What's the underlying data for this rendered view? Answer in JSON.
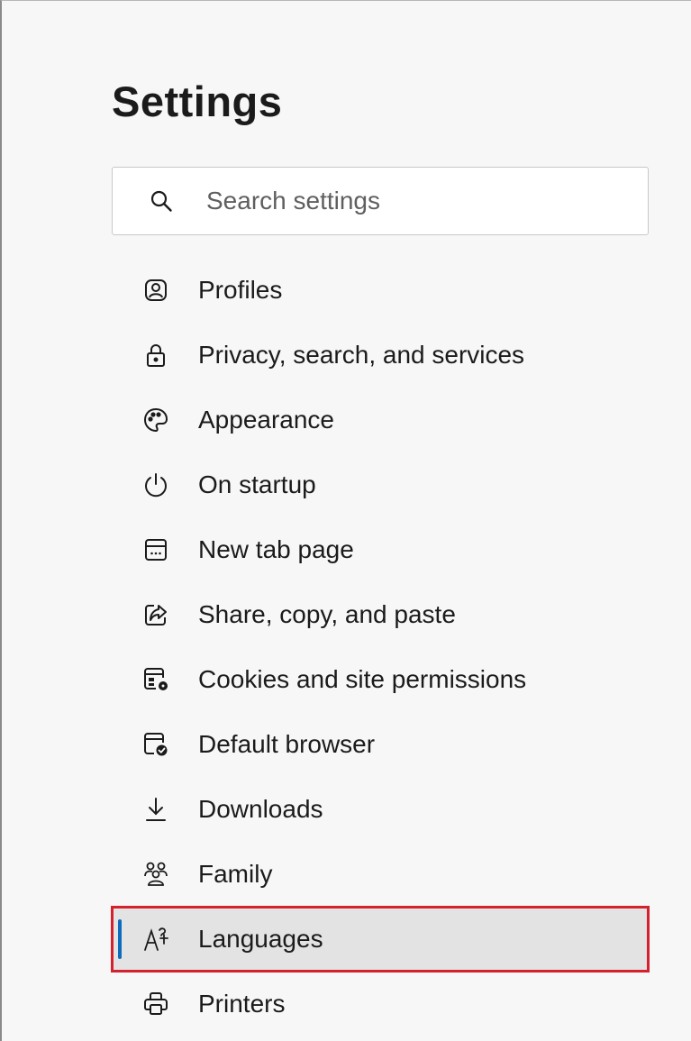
{
  "page": {
    "title": "Settings"
  },
  "search": {
    "icon": "search-icon",
    "placeholder": "Search settings"
  },
  "nav": {
    "items": [
      {
        "id": "profiles",
        "label": "Profiles",
        "icon": "profile-icon"
      },
      {
        "id": "privacy",
        "label": "Privacy, search, and services",
        "icon": "lock-icon"
      },
      {
        "id": "appearance",
        "label": "Appearance",
        "icon": "palette-icon"
      },
      {
        "id": "startup",
        "label": "On startup",
        "icon": "power-icon"
      },
      {
        "id": "newtab",
        "label": "New tab page",
        "icon": "new-tab-icon"
      },
      {
        "id": "share",
        "label": "Share, copy, and paste",
        "icon": "share-icon"
      },
      {
        "id": "cookies",
        "label": "Cookies and site permissions",
        "icon": "cookies-permissions-icon"
      },
      {
        "id": "default-browser",
        "label": "Default browser",
        "icon": "default-browser-icon"
      },
      {
        "id": "downloads",
        "label": "Downloads",
        "icon": "download-icon"
      },
      {
        "id": "family",
        "label": "Family",
        "icon": "family-icon"
      },
      {
        "id": "languages",
        "label": "Languages",
        "icon": "languages-icon",
        "selected": true
      },
      {
        "id": "printers",
        "label": "Printers",
        "icon": "printer-icon"
      }
    ]
  },
  "colors": {
    "accent": "#0f6cbd",
    "highlight_border": "#d5202e",
    "selected_background": "#e3e3e3"
  }
}
